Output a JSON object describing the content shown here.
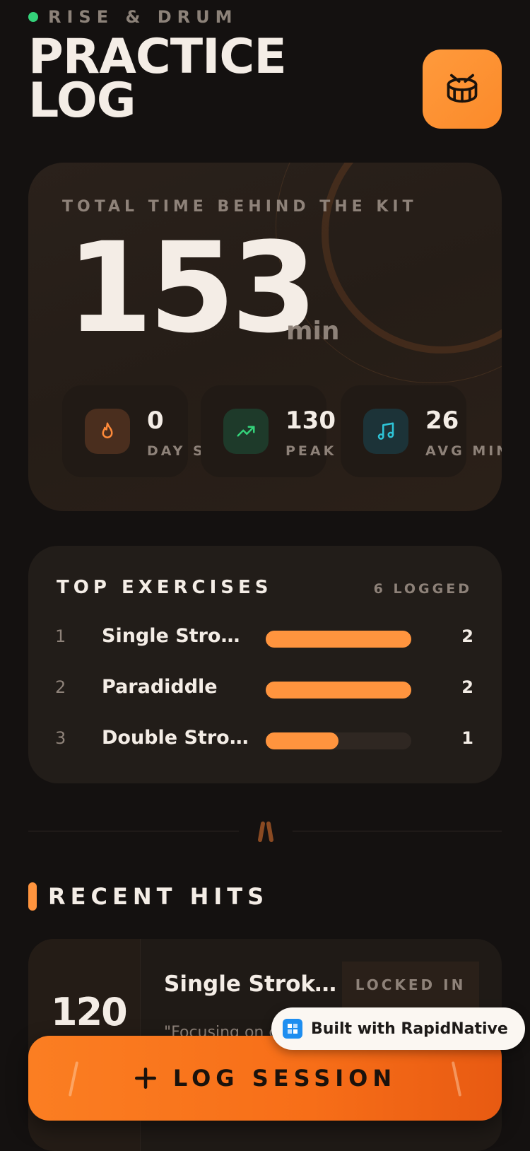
{
  "header": {
    "brand": "RISE & DRUM",
    "title_line1": "PRACTICE",
    "title_line2": "LOG",
    "drum_icon": "drum-icon"
  },
  "total": {
    "label": "TOTAL TIME BEHIND THE KIT",
    "value": "153",
    "unit": "min"
  },
  "stats": [
    {
      "value": "0",
      "label": "DAY STREAK",
      "icon": "flame-icon",
      "color": "#ff8a3a"
    },
    {
      "value": "130",
      "label": "PEAK BPM",
      "icon": "trending-up-icon",
      "color": "#34d27a"
    },
    {
      "value": "26",
      "label": "AVG MIN",
      "icon": "music-note-icon",
      "color": "#2ec5d8"
    }
  ],
  "exercises": {
    "title": "TOP EXERCISES",
    "count": "6 LOGGED",
    "max": 2,
    "items": [
      {
        "rank": "1",
        "name": "Single Stroke...",
        "value": "2",
        "n": 2
      },
      {
        "rank": "2",
        "name": "Paradiddle",
        "value": "2",
        "n": 2
      },
      {
        "rank": "3",
        "name": "Double Strok...",
        "value": "1",
        "n": 1
      }
    ]
  },
  "recent": {
    "title": "RECENT HITS",
    "card": {
      "bpm": "120",
      "name": "Single Stroke...",
      "tag": "LOCKED IN",
      "note": "\"Focusing on c"
    }
  },
  "log_button": {
    "label": "LOG SESSION",
    "icon": "plus-icon"
  },
  "badge": {
    "text": "Built with RapidNative"
  },
  "colors": {
    "accent": "#ff943e",
    "background": "#141110"
  }
}
